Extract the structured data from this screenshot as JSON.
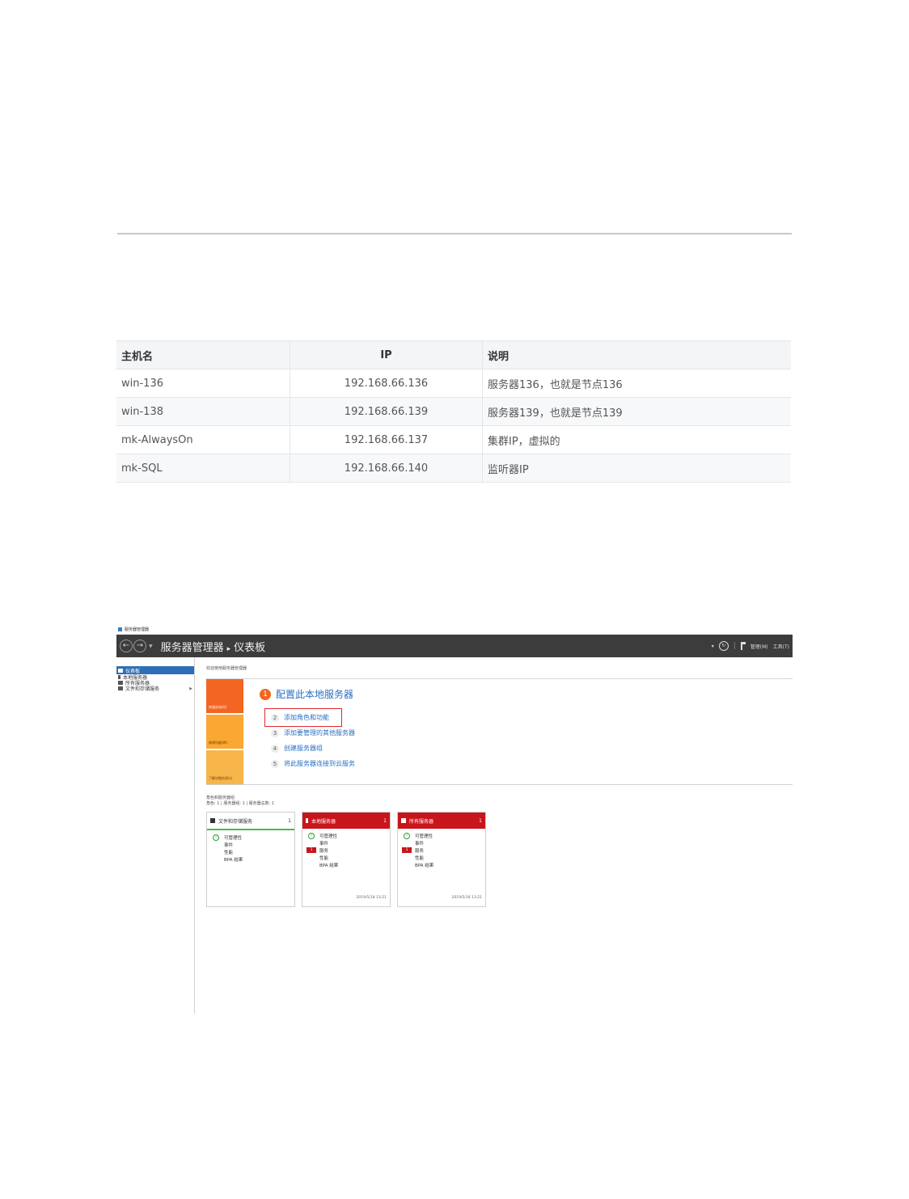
{
  "table": {
    "headers": [
      "主机名",
      "IP",
      "说明"
    ],
    "rows": [
      [
        "win-136",
        "192.168.66.136",
        "服务器136，也就是节点136"
      ],
      [
        "win-138",
        "192.168.66.139",
        "服务器139，也就是节点139"
      ],
      [
        "mk-AlwaysOn",
        "192.168.66.137",
        "集群IP，虚拟的"
      ],
      [
        "mk-SQL",
        "192.168.66.140",
        "监听器IP"
      ]
    ]
  },
  "server_manager": {
    "window_title": "服务器管理器",
    "breadcrumb": {
      "app": "服务器管理器",
      "sep": "▸",
      "page": "仪表板"
    },
    "menu": {
      "manage": "管理(M)",
      "tools": "工具(T)"
    },
    "sidebar": [
      {
        "label": "仪表板",
        "active": true
      },
      {
        "label": "本地服务器"
      },
      {
        "label": "所有服务器"
      },
      {
        "label": "文件和存储服务"
      }
    ],
    "welcome": "欢迎使用服务器管理器",
    "tiles": [
      "快速启动(Q)",
      "新增功能(W)",
      "了解详细信息(L)"
    ],
    "quick_start": {
      "title_num": "1",
      "title": "配置此本地服务器",
      "steps": [
        {
          "num": "2",
          "label": "添加角色和功能"
        },
        {
          "num": "3",
          "label": "添加要管理的其他服务器"
        },
        {
          "num": "4",
          "label": "创建服务器组"
        },
        {
          "num": "5",
          "label": "将此服务器连接到云服务"
        }
      ]
    },
    "roles_heading": "角色和服务器组",
    "roles_summary": "角色: 1 | 服务器组: 1 | 服务器总数: 1",
    "cards": [
      {
        "title": "文件和存储服务",
        "count": "1",
        "rows": [
          "可管理性",
          "事件",
          "性能",
          "BPA 结果"
        ],
        "time": ""
      },
      {
        "title": "本地服务器",
        "count": "1",
        "rows": [
          "可管理性",
          "事件",
          "服务",
          "性能",
          "BPA 结果"
        ],
        "alert": "1",
        "time": "2019/5/18 13:21"
      },
      {
        "title": "所有服务器",
        "count": "1",
        "rows": [
          "可管理性",
          "事件",
          "服务",
          "性能",
          "BPA 结果"
        ],
        "alert": "1",
        "time": "2019/5/18 13:21"
      }
    ]
  }
}
